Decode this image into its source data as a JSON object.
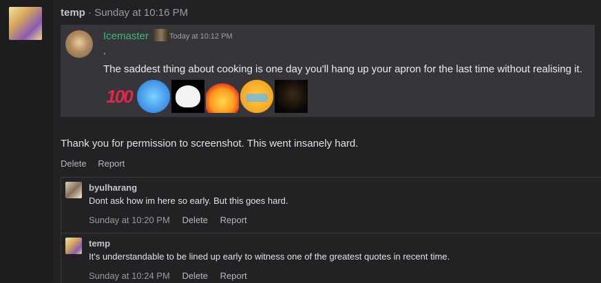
{
  "post": {
    "username": "temp",
    "separator": "·",
    "timestamp": "Sunday at 10:16 PM",
    "quote": {
      "author": "Icemaster",
      "time": "Today at 10:12 PM",
      "dot": ".",
      "text": "The saddest thing about cooking is one day you'll hang up your apron for the last time without realising it.",
      "emojis": [
        {
          "name": "hundred-points-emoji",
          "glyph": "100"
        },
        {
          "name": "cold-face-emoji",
          "glyph": ""
        },
        {
          "name": "troll-face-emoji",
          "glyph": ""
        },
        {
          "name": "fire-emoji",
          "glyph": ""
        },
        {
          "name": "crying-face-emoji",
          "glyph": ""
        },
        {
          "name": "dark-face-emoji",
          "glyph": ""
        }
      ]
    },
    "text": "Thank you for permission to screenshot. This went insanely hard.",
    "actions": {
      "delete": "Delete",
      "report": "Report"
    }
  },
  "replies": [
    {
      "username": "byulharang",
      "text": "Dont ask how im here so early. But this goes hard.",
      "time": "Sunday at 10:20 PM",
      "delete": "Delete",
      "report": "Report"
    },
    {
      "username": "temp",
      "text": "It's understandable to be lined up early to witness one of the greatest quotes in recent time.",
      "time": "Sunday at 10:24 PM",
      "delete": "Delete",
      "report": "Report"
    }
  ]
}
